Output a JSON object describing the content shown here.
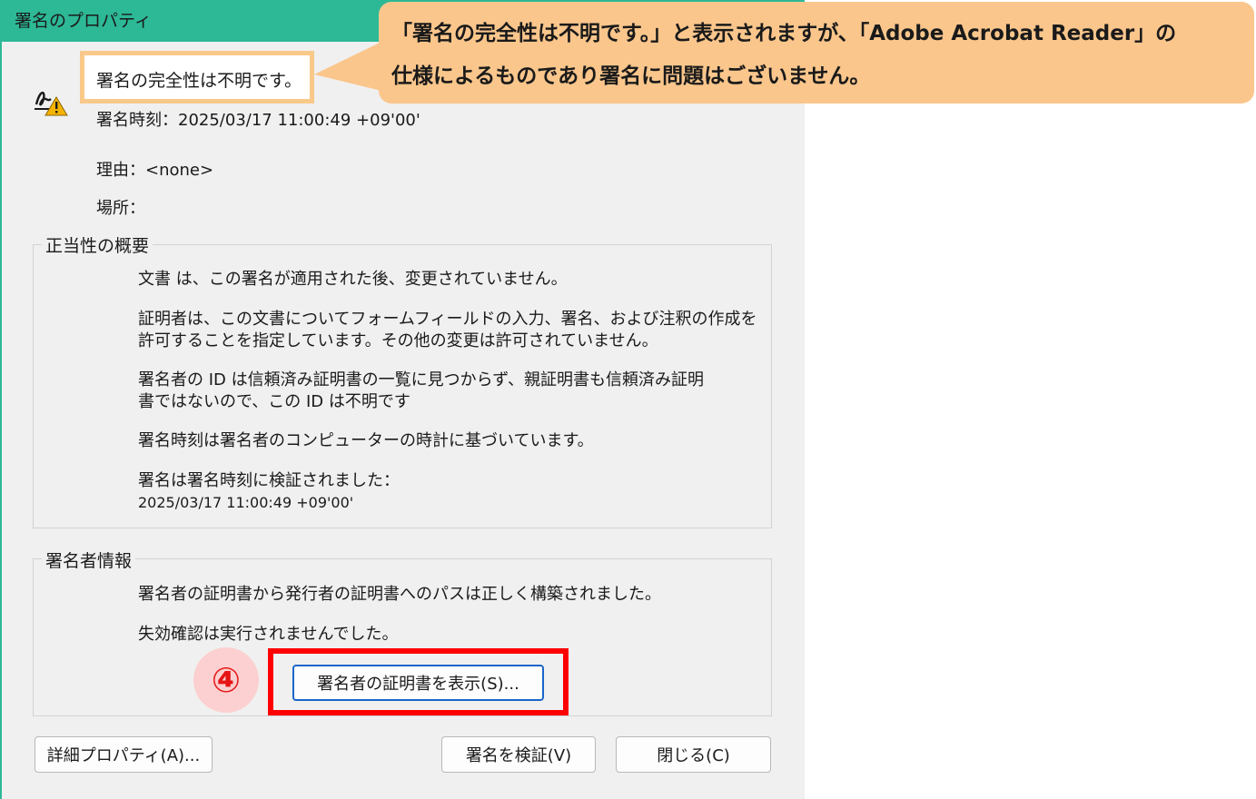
{
  "window": {
    "title": "署名のプロパティ"
  },
  "signature": {
    "integrity_status": "署名の完全性は不明です。",
    "time_label": "署名時刻：2025/03/17 11:00:49 +09'00'",
    "reason_label": "理由：<none>",
    "location_label": "場所："
  },
  "validity_summary": {
    "title": "正当性の概要",
    "paragraphs": [
      [
        "文書 は、この署名が適用された後、変更されていません。"
      ],
      [
        "証明者は、この文書についてフォームフィールドの入力、署名、および注釈の作成を",
        "許可することを指定しています。その他の変更は許可されていません。"
      ],
      [
        "署名者の ID は信頼済み証明書の一覧に見つからず、親証明書も信頼済み証明",
        "書ではないので、この ID は不明です"
      ],
      [
        "署名時刻は署名者のコンピューターの時計に基づいています。"
      ],
      [
        "署名は署名時刻に検証されました：",
        "2025/03/17 11:00:49 +09'00'"
      ]
    ]
  },
  "signer_info": {
    "title": "署名者情報",
    "paragraphs": [
      "署名者の証明書から発行者の証明書へのパスは正しく構築されました。",
      "失効確認は実行されませんでした。"
    ],
    "show_certificate_button": "署名者の証明書を表示(S)..."
  },
  "footer": {
    "advanced_properties_button": "詳細プロパティ(A)...",
    "validate_signature_button": "署名を検証(V)",
    "close_button": "閉じる(C)"
  },
  "annotation": {
    "step_number": "④",
    "callout_lines": [
      "「署名の完全性は不明です。」と表示されますが、「Adobe Acrobat Reader」の",
      "仕様によるものであり署名に問題はございません。"
    ],
    "colors": {
      "callout": "#fac68c",
      "highlight_frame": "#ff0000",
      "badge_bg": "#fcd0d0",
      "badge_text": "#e61414"
    }
  },
  "icons": {
    "signature": "signature-warning-icon"
  }
}
